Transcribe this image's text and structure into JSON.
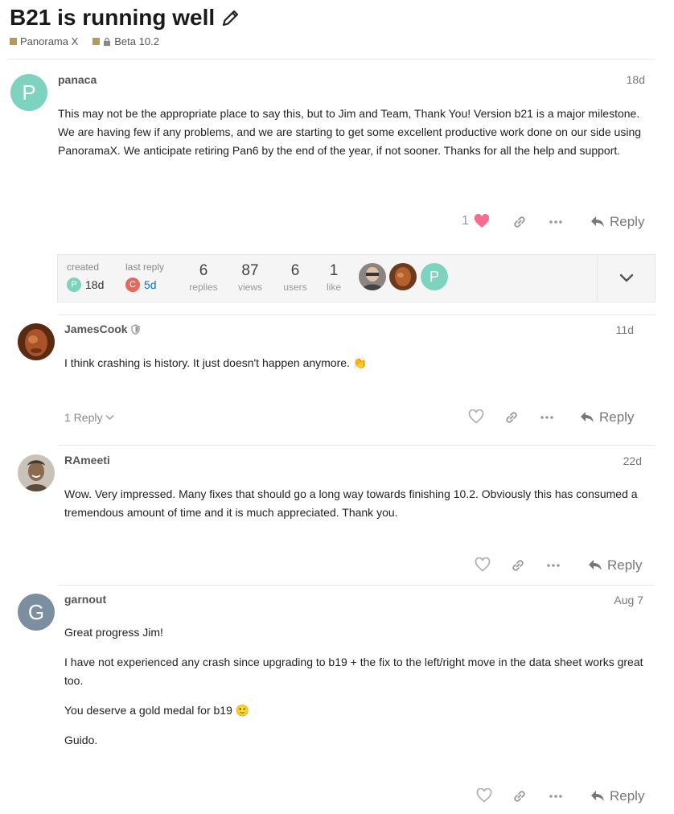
{
  "topic": {
    "title": "B21 is running well",
    "category": "Panorama X",
    "category_color": "#b5985a",
    "subcategory": "Beta 10.2",
    "subcategory_color": "#b5985a"
  },
  "posts": [
    {
      "author": "panaca",
      "avatar_letter": "P",
      "avatar_color": "#7dd3c0",
      "date": "18d",
      "paragraphs": [
        "This may not be the appropriate place to say this, but to Jim and Team, Thank You! Version b21 is a major milestone. We are having few if any problems, and we are starting to get some excellent productive work done on our side using PanoramaX. We anticipate retiring Pan6 by the end of the year, if not sooner. Thanks for all the help and support."
      ],
      "like_count": "1",
      "reply_label": "Reply"
    },
    {
      "author": "JamesCook",
      "date": "11d",
      "paragraphs": [
        "I think crashing is history. It just doesn't happen anymore. 👏"
      ],
      "replies_toggle": "1 Reply",
      "reply_label": "Reply"
    },
    {
      "author": "RAmeeti",
      "date": "22d",
      "paragraphs": [
        "Wow. Very impressed. Many fixes that should go a long way towards finishing 10.2. Obviously this has consumed a tremendous amount of time and it is much appreciated. Thank you."
      ],
      "reply_label": "Reply"
    },
    {
      "author": "garnout",
      "avatar_letter": "G",
      "avatar_color": "#7b8fa1",
      "date": "Aug 7",
      "paragraphs": [
        "Great progress Jim!",
        "I have not experienced any crash since upgrading to b19 + the fix to the left/right move in the data sheet works great too.",
        "You deserve a gold medal for b19 🙂",
        "Guido."
      ],
      "reply_label": "Reply"
    }
  ],
  "topic_map": {
    "created_label": "created",
    "created_letter": "P",
    "created_color": "#7dd3c0",
    "created_value": "18d",
    "last_reply_label": "last reply",
    "last_reply_letter": "C",
    "last_reply_color": "#e46a5e",
    "last_reply_value": "5d",
    "stats": [
      {
        "num": "6",
        "label": "replies"
      },
      {
        "num": "87",
        "label": "views"
      },
      {
        "num": "6",
        "label": "users"
      },
      {
        "num": "1",
        "label": "like"
      }
    ],
    "participant_letter": "P",
    "participant_color": "#7dd3c0"
  }
}
